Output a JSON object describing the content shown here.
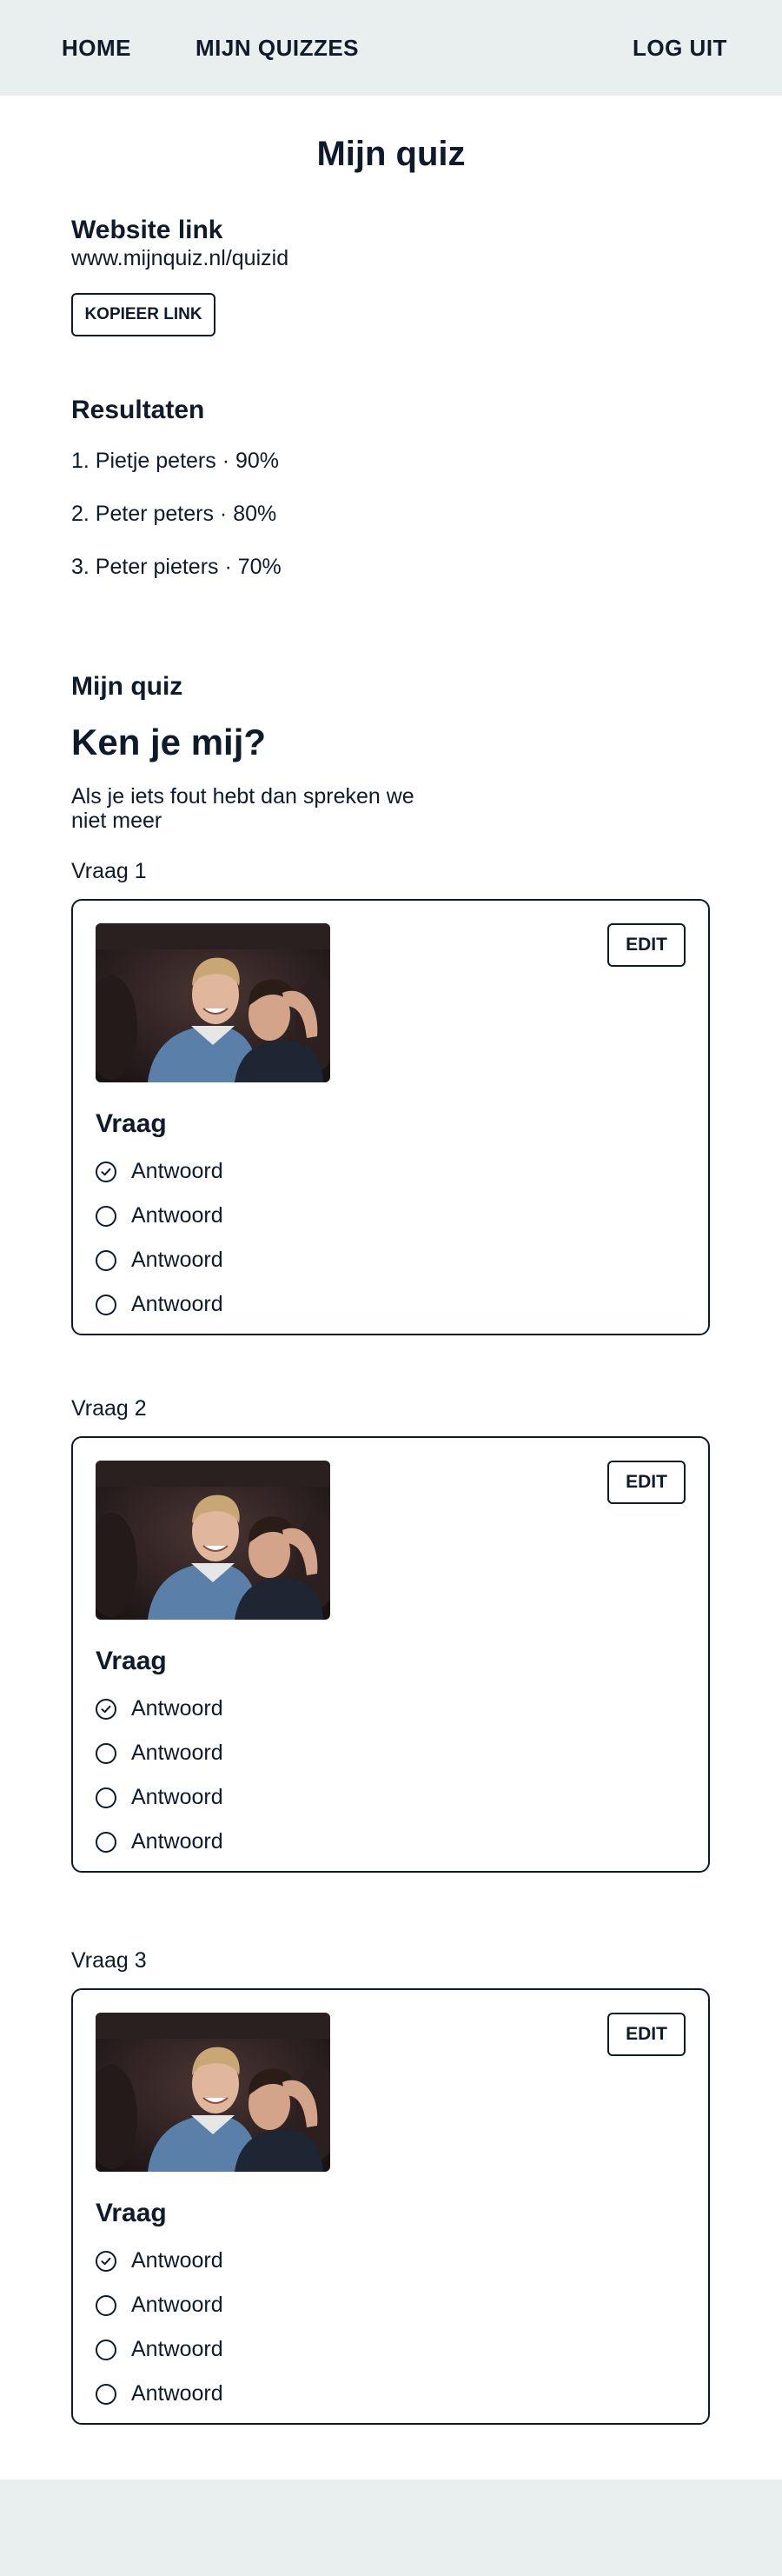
{
  "nav": {
    "home": "HOME",
    "my_quizzes": "MIJN QUIZZES",
    "logout": "LOG UIT"
  },
  "page_title": "Mijn quiz",
  "website": {
    "heading": "Website link",
    "url": "www.mijnquiz.nl/quizid",
    "copy_button": "KOPIEER LINK"
  },
  "results": {
    "heading": "Resultaten",
    "items": [
      "1. Pietje peters · 90%",
      "2. Peter peters · 80%",
      "3. Peter pieters · 70%"
    ]
  },
  "quiz": {
    "section_heading": "Mijn quiz",
    "title": "Ken je mij?",
    "description": "Als je iets fout hebt dan spreken we niet meer",
    "questions": [
      {
        "label": "Vraag 1",
        "edit_label": "EDIT",
        "question": "Vraag",
        "answers": [
          {
            "label": "Antwoord",
            "checked": true
          },
          {
            "label": "Antwoord",
            "checked": false
          },
          {
            "label": "Antwoord",
            "checked": false
          },
          {
            "label": "Antwoord",
            "checked": false
          }
        ]
      },
      {
        "label": "Vraag 2",
        "edit_label": "EDIT",
        "question": "Vraag",
        "answers": [
          {
            "label": "Antwoord",
            "checked": true
          },
          {
            "label": "Antwoord",
            "checked": false
          },
          {
            "label": "Antwoord",
            "checked": false
          },
          {
            "label": "Antwoord",
            "checked": false
          }
        ]
      },
      {
        "label": "Vraag 3",
        "edit_label": "EDIT",
        "question": "Vraag",
        "answers": [
          {
            "label": "Antwoord",
            "checked": true
          },
          {
            "label": "Antwoord",
            "checked": false
          },
          {
            "label": "Antwoord",
            "checked": false
          },
          {
            "label": "Antwoord",
            "checked": false
          }
        ]
      }
    ]
  },
  "colors": {
    "nav_background": "#e9eeee",
    "text": "#0f1b2b",
    "background": "#ffffff"
  }
}
